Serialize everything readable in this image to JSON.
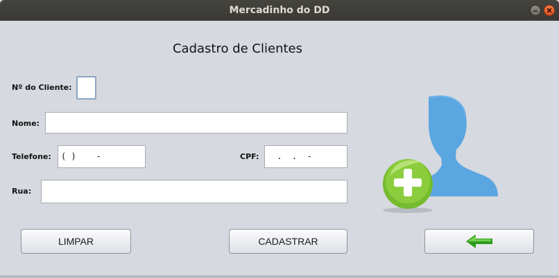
{
  "window": {
    "title": "Mercadinho do DD"
  },
  "form": {
    "heading": "Cadastro de Clientes",
    "cliente_label": "Nº do Cliente:",
    "cliente_value": "",
    "nome_label": "Nome:",
    "nome_value": "",
    "telefone_label": "Telefone:",
    "telefone_value": "( )    -",
    "cpf_label": "CPF:",
    "cpf_value": " .  .  -",
    "rua_label": "Rua:",
    "rua_value": ""
  },
  "buttons": {
    "limpar": "LIMPAR",
    "cadastrar": "CADASTRAR",
    "back_icon": "green-left-arrow-icon"
  },
  "icons": {
    "avatar": "add-user-icon",
    "avatar_color": "#5aa6e0",
    "plus_color": "#7cc23a"
  }
}
